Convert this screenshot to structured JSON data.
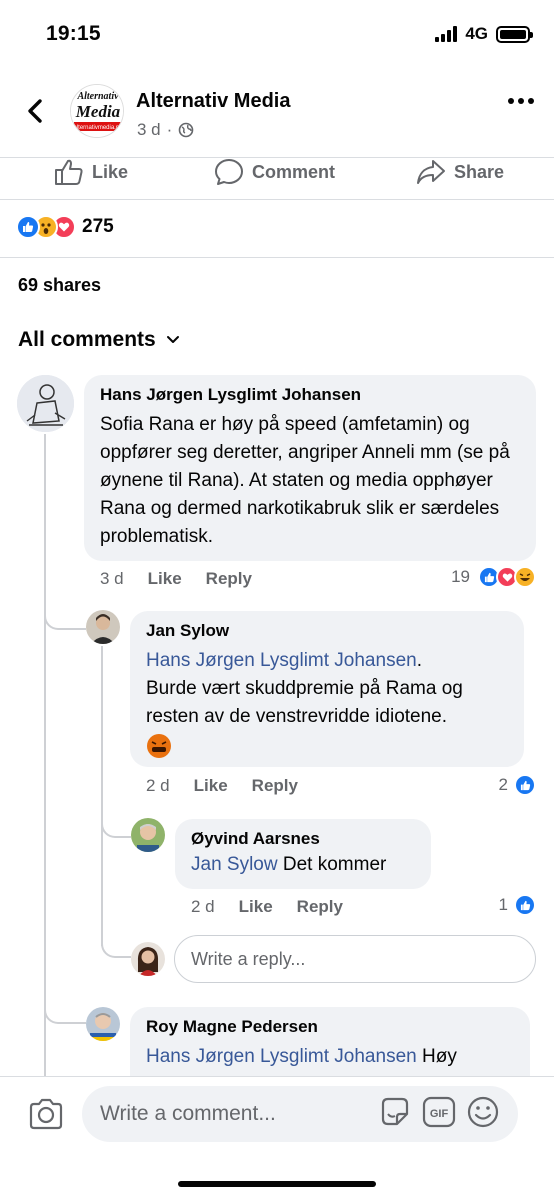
{
  "status_bar": {
    "time": "19:15",
    "network": "4G",
    "battery_level": 1.0
  },
  "header": {
    "page_name": "Alternativ Media",
    "post_time": "3 d",
    "separator": "·",
    "logo_text_top": "Alternativ",
    "logo_text_main": "Media",
    "logo_text_url": "alternativmedia.no"
  },
  "actions": {
    "like": "Like",
    "comment": "Comment",
    "share": "Share"
  },
  "reactions": {
    "count": "275",
    "types": [
      "like-icon",
      "wow-icon",
      "love-icon"
    ]
  },
  "shares_label": "69 shares",
  "sort_label": "All comments",
  "comments": [
    {
      "author": "Hans Jørgen Lysglimt Johansen",
      "text": "Sofia Rana er høy på speed (amfetamin) og oppfører seg deretter, angriper Anneli mm (se på øynene til Rana). At staten og media opphøyer Rana og dermed narkotikabruk slik er særdeles problematisk.",
      "time": "3 d",
      "like_label": "Like",
      "reply_label": "Reply",
      "reaction_count": "19"
    },
    {
      "author": "Jan Sylow",
      "mention": "Hans Jørgen Lysglimt Johansen",
      "mention_suffix": ".",
      "text": "Burde vært skuddpremie på Rama og resten av de venstrevridde idiotene.",
      "time": "2 d",
      "like_label": "Like",
      "reply_label": "Reply",
      "reaction_count": "2"
    },
    {
      "author": "Øyvind Aarsnes",
      "mention": "Jan Sylow",
      "text": "Det kommer",
      "time": "2 d",
      "like_label": "Like",
      "reply_label": "Reply",
      "reaction_count": "1"
    },
    {
      "author": "Roy Magne Pedersen",
      "mention": "Hans Jørgen Lysglimt Johansen",
      "text": "Høy"
    }
  ],
  "reply_placeholder": "Write a reply...",
  "comment_placeholder": "Write a comment...",
  "gif_label": "GIF",
  "colors": {
    "brand_blue": "#1877f2",
    "link": "#385898",
    "muted": "#65676b",
    "bubble": "#f0f2f5"
  }
}
